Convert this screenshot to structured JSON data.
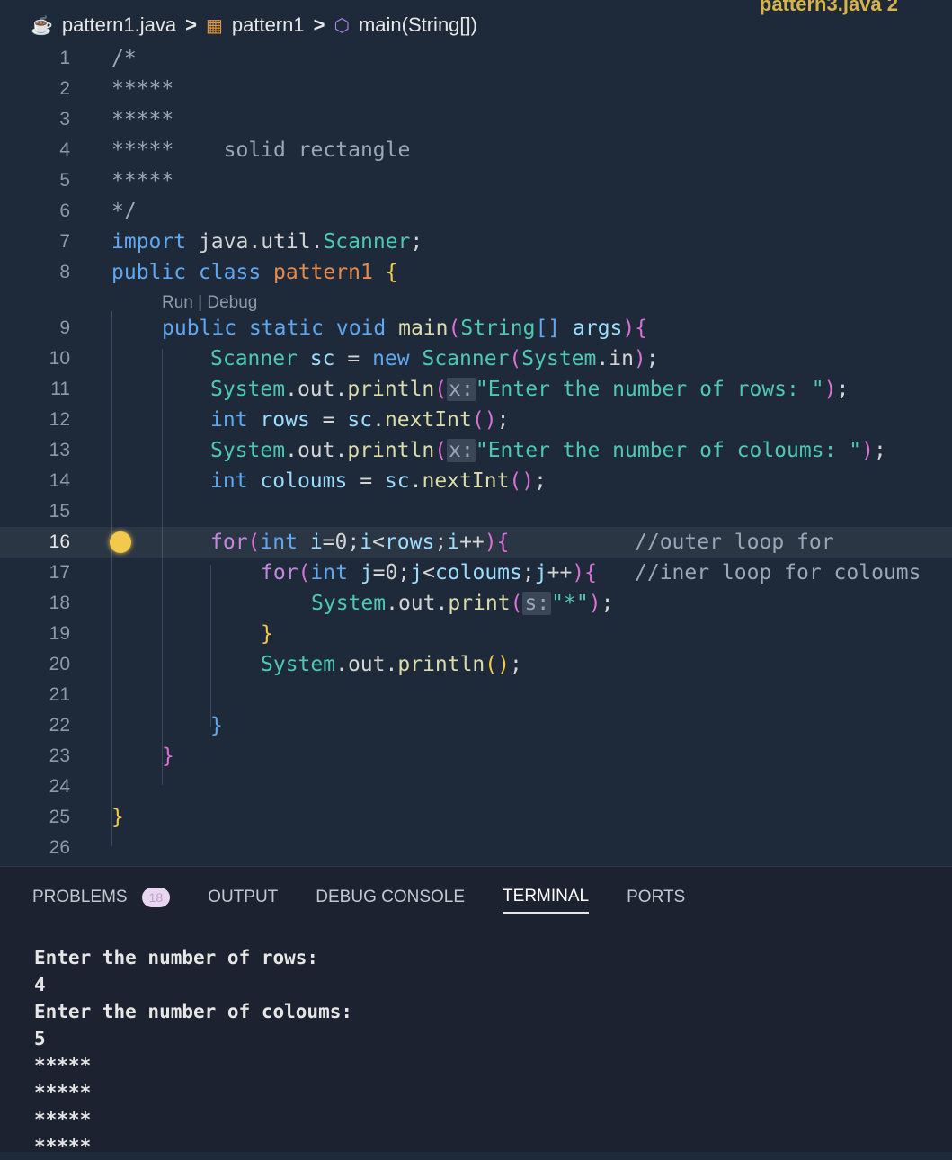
{
  "top_right_file": "pattern3.java 2",
  "breadcrumb": {
    "file": "pattern1.java",
    "class": "pattern1",
    "method": "main(String[])",
    "file_icon": "java-icon",
    "class_icon": "class-icon",
    "method_icon": "method-icon"
  },
  "codelens": "Run | Debug",
  "code_lines": [
    {
      "n": "1",
      "code": "/*"
    },
    {
      "n": "2",
      "code": "*****"
    },
    {
      "n": "3",
      "code": "*****"
    },
    {
      "n": "4",
      "code": "*****    solid rectangle"
    },
    {
      "n": "5",
      "code": "*****"
    },
    {
      "n": "6",
      "code": "*/"
    },
    {
      "n": "7",
      "code": "import java.util.Scanner;"
    },
    {
      "n": "8",
      "code": "public class pattern1 {"
    },
    {
      "n": "9",
      "code": "public static void main(String[] args){"
    },
    {
      "n": "10",
      "code": "Scanner sc = new Scanner(System.in);"
    },
    {
      "n": "11",
      "code": "System.out.println(x:\"Enter the number of rows: \");"
    },
    {
      "n": "12",
      "code": "int rows = sc.nextInt();"
    },
    {
      "n": "13",
      "code": "System.out.println(x:\"Enter the number of coloums: \");"
    },
    {
      "n": "14",
      "code": "int coloums = sc.nextInt();"
    },
    {
      "n": "15",
      "code": ""
    },
    {
      "n": "16",
      "code": "for(int i=0;i<rows;i++){          //outer loop for"
    },
    {
      "n": "17",
      "code": "for(int j=0;j<coloums;j++){  //iner loop for coloums"
    },
    {
      "n": "18",
      "code": "System.out.print(s:\"*\");"
    },
    {
      "n": "19",
      "code": "}"
    },
    {
      "n": "20",
      "code": "System.out.println();"
    },
    {
      "n": "21",
      "code": ""
    },
    {
      "n": "22",
      "code": "}"
    },
    {
      "n": "23",
      "code": "}"
    },
    {
      "n": "24",
      "code": ""
    },
    {
      "n": "25",
      "code": "}"
    },
    {
      "n": "26",
      "code": ""
    }
  ],
  "panel": {
    "tabs": [
      "PROBLEMS",
      "OUTPUT",
      "DEBUG CONSOLE",
      "TERMINAL",
      "PORTS"
    ],
    "problems_count": "18",
    "active_tab": "TERMINAL"
  },
  "terminal": {
    "lines": [
      "Enter the number of rows:",
      "4",
      "Enter the number of coloums:",
      "5",
      "*****",
      "*****",
      "*****",
      "*****"
    ]
  },
  "colors": {
    "background": "#1e2a3a",
    "keyword": "#5fa8f0",
    "class_name": "#4ec9b0",
    "control": "#c586e0",
    "lightbulb": "#f2c94c"
  }
}
